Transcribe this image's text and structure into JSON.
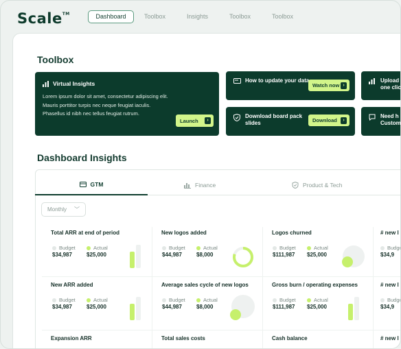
{
  "brand": {
    "logo": "Scale",
    "trademark": "TM"
  },
  "nav": {
    "tabs": [
      "Dashboard",
      "Toolbox",
      "Insights",
      "Toolbox",
      "Toolbox"
    ],
    "active": 0
  },
  "toolbox": {
    "title": "Toolbox",
    "featured": {
      "title": "Virtual Insights",
      "description": "Lorem ipsum dolor sit amet, consectetur adipiscing elit. Mauris porttitor turpis nec neque feugiat iaculis. Phasellus id nibh nec tellus feugiat rutrum.",
      "button": "Launch"
    },
    "cards": [
      {
        "title": "How to update your data",
        "button": "Watch now",
        "icon": "monitor-icon"
      },
      {
        "title": "Download board pack slides",
        "button": "Download",
        "icon": "shield-check-icon"
      }
    ],
    "edge_cards": [
      {
        "title": "Upload",
        "title2": "one clic",
        "icon": "bar-chart-icon"
      },
      {
        "title": "Need h",
        "title2": "Custom",
        "icon": "chat-icon"
      }
    ]
  },
  "insights": {
    "title": "Dashboard Insights",
    "tabs": [
      {
        "label": "GTM",
        "icon": "card-icon"
      },
      {
        "label": "Finance",
        "icon": "bar-chart-icon"
      },
      {
        "label": "Product & Tech",
        "icon": "shield-icon"
      }
    ],
    "period": "Monthly",
    "budget_label": "Budget",
    "actual_label": "Actual",
    "metrics": [
      {
        "title": "Total ARR at end of period",
        "budget": "$34,987",
        "actual": "$25,000",
        "visual": "bars",
        "level": 0.71
      },
      {
        "title": "New logos added",
        "budget": "$44,987",
        "actual": "$8,000",
        "visual": "ring",
        "level": 0.8
      },
      {
        "title": "Logos churned",
        "budget": "$111,987",
        "actual": "$25,000",
        "visual": "circles"
      },
      {
        "title": "# new l",
        "budget": "$34,9",
        "actual": ""
      },
      {
        "title": "New ARR added",
        "budget": "$34,987",
        "actual": "$25,000",
        "visual": "bars",
        "level": 0.71
      },
      {
        "title": "Average sales cycle of new logos",
        "budget": "$44,987",
        "actual": "$8,000",
        "visual": "circles"
      },
      {
        "title": "Gross burn / operating expenses",
        "budget": "$111,987",
        "actual": "$25,000",
        "visual": "bars",
        "level": 0.71
      },
      {
        "title": "# new l",
        "budget": "$34,9",
        "actual": ""
      },
      {
        "title": "Expansion ARR"
      },
      {
        "title": "Total sales costs"
      },
      {
        "title": "Cash balance"
      },
      {
        "title": "# new l"
      }
    ]
  },
  "colors": {
    "brand_dark": "#0c3b2c",
    "accent_lime": "#c6f06c",
    "button_lime": "#d2f58a",
    "muted": "#e3e8e6"
  }
}
